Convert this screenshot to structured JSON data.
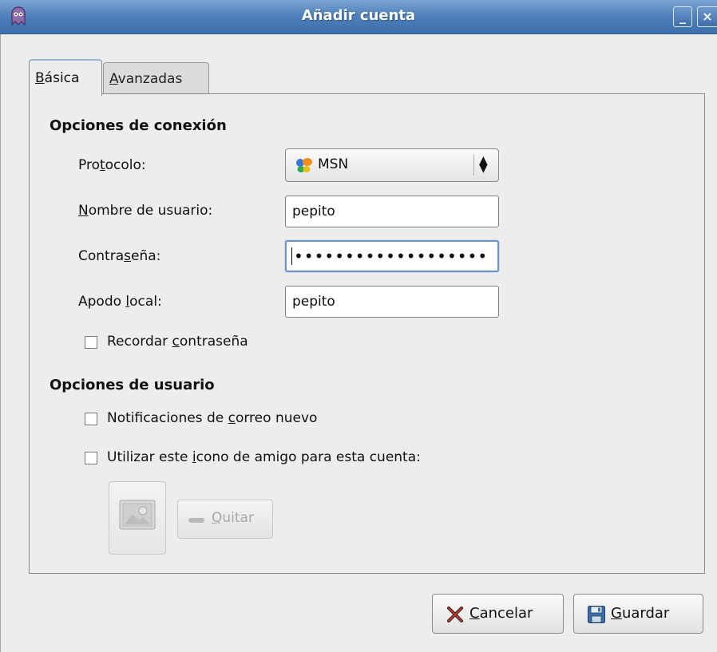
{
  "window": {
    "title": "Añadir cuenta",
    "minimize_glyph": "_",
    "close_glyph": "×"
  },
  "tabs": [
    {
      "label_pre": "",
      "label_mn": "B",
      "label_post": "ásica",
      "active": true
    },
    {
      "label_pre": "",
      "label_mn": "A",
      "label_post": "vanzadas",
      "active": false
    }
  ],
  "connection": {
    "section_title": "Opciones de conexión",
    "protocol": {
      "label_pre": "Pro",
      "label_mn": "t",
      "label_post": "ocolo:",
      "value": "MSN",
      "icon": "msn-butterfly-icon"
    },
    "username": {
      "label_pre": "",
      "label_mn": "N",
      "label_post": "ombre de usuario:",
      "value": "pepito"
    },
    "password": {
      "label_pre": "Contra",
      "label_mn": "s",
      "label_post": "eña:",
      "value_masked": "•••••••••••••••••••"
    },
    "alias": {
      "label_pre": "Apodo ",
      "label_mn": "l",
      "label_post": "ocal:",
      "value": "pepito"
    },
    "remember": {
      "label_pre": "Recordar ",
      "label_mn": "c",
      "label_post": "ontraseña",
      "checked": false
    }
  },
  "user_options": {
    "section_title": "Opciones de usuario",
    "new_mail": {
      "label_pre": "Notificaciones de ",
      "label_mn": "c",
      "label_post": "orreo nuevo",
      "checked": false
    },
    "buddy_icon": {
      "label_pre": "Utilizar este ",
      "label_mn": "i",
      "label_post": "cono de amigo para esta cuenta:",
      "checked": false
    },
    "remove_button": {
      "label_pre": "",
      "label_mn": "Q",
      "label_post": "uitar",
      "enabled": false
    }
  },
  "buttons": {
    "cancel": {
      "label_pre": "",
      "label_mn": "C",
      "label_post": "ancelar",
      "icon": "cancel-x-icon"
    },
    "save": {
      "label_pre": "",
      "label_mn": "G",
      "label_post": "uardar",
      "icon": "floppy-save-icon"
    }
  },
  "colors": {
    "titlebar": "#4d7fbb",
    "window_bg": "#ededed",
    "focus_border": "#6d95c9"
  }
}
